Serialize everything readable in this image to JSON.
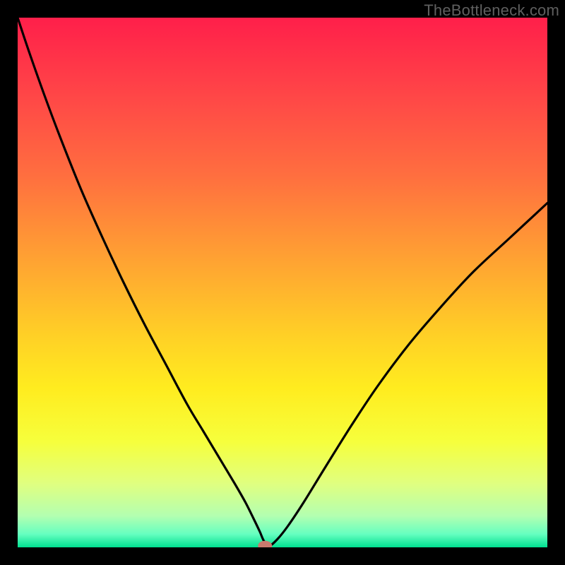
{
  "watermark": "TheBottleneck.com",
  "chart_data": {
    "type": "line",
    "title": "",
    "xlabel": "",
    "ylabel": "",
    "xlim": [
      0,
      100
    ],
    "ylim": [
      0,
      100
    ],
    "background_gradient_stops": [
      {
        "offset": 0.0,
        "color": "#ff1f4a"
      },
      {
        "offset": 0.15,
        "color": "#ff4747"
      },
      {
        "offset": 0.3,
        "color": "#ff6f3f"
      },
      {
        "offset": 0.45,
        "color": "#ffa033"
      },
      {
        "offset": 0.6,
        "color": "#ffd026"
      },
      {
        "offset": 0.7,
        "color": "#ffec1f"
      },
      {
        "offset": 0.8,
        "color": "#f6ff3c"
      },
      {
        "offset": 0.88,
        "color": "#e0ff80"
      },
      {
        "offset": 0.94,
        "color": "#b4ffb0"
      },
      {
        "offset": 0.975,
        "color": "#66ffc0"
      },
      {
        "offset": 1.0,
        "color": "#00e090"
      }
    ],
    "series": [
      {
        "name": "bottleneck-curve",
        "x": [
          0,
          2,
          5,
          8,
          12,
          16,
          20,
          24,
          28,
          32,
          35,
          38,
          41,
          43,
          44.5,
          45.7,
          46.5,
          47.5,
          49,
          51,
          54,
          58,
          63,
          68,
          74,
          80,
          86,
          93,
          100
        ],
        "y": [
          100,
          94,
          85.5,
          77.5,
          67.5,
          58.5,
          50,
          42,
          34.5,
          27,
          22,
          17,
          12,
          8.5,
          5.5,
          3,
          1.2,
          0.3,
          1.5,
          4,
          8.5,
          15,
          23,
          30.5,
          38.5,
          45.5,
          52,
          58.5,
          65
        ]
      }
    ],
    "marker": {
      "x": 46.7,
      "y": 0.3,
      "color": "#c97a6e"
    }
  }
}
